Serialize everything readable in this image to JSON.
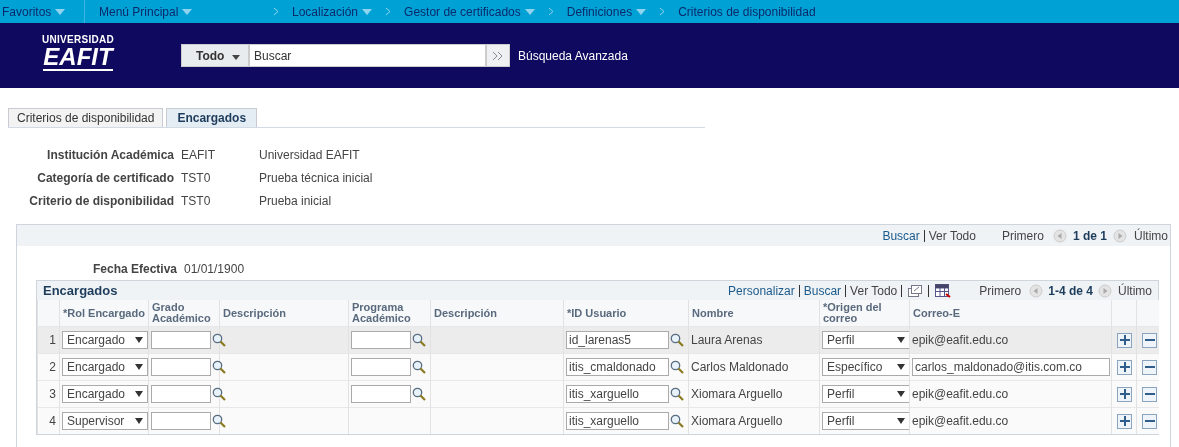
{
  "nav": {
    "items": [
      {
        "label": "Favoritos",
        "dropdown": true
      },
      {
        "label": "Menú Principal",
        "dropdown": true
      },
      {
        "label": "Localización",
        "dropdown": true
      },
      {
        "label": "Gestor de certificados",
        "dropdown": true
      },
      {
        "label": "Definiciones",
        "dropdown": true
      },
      {
        "label": "Criterios de disponibilidad",
        "dropdown": false
      }
    ]
  },
  "header": {
    "logo_top": "UNIVERSIDAD",
    "logo_main": "EAFIT",
    "search_scope": "Todo",
    "search_placeholder": "Buscar",
    "advanced": "Búsqueda Avanzada"
  },
  "tabs": [
    {
      "label": "Criterios de disponibilidad",
      "selected": false
    },
    {
      "label": "Encargados",
      "selected": true
    }
  ],
  "fields": [
    {
      "label": "Institución Académica",
      "code": "EAFIT",
      "description": "Universidad EAFIT"
    },
    {
      "label": "Categoría de certificado",
      "code": "TST0",
      "description": "Prueba técnica inicial"
    },
    {
      "label": "Criterio de disponibilidad",
      "code": "TST0",
      "description": "Prueba inicial"
    }
  ],
  "outer_nav": {
    "find": "Buscar",
    "view_all": "Ver Todo",
    "first": "Primero",
    "count": "1 de 1",
    "last": "Último"
  },
  "effective_date": {
    "label": "Fecha Efectiva",
    "value": "01/01/1900"
  },
  "grid": {
    "title": "Encargados",
    "personalize": "Personalizar",
    "find": "Buscar",
    "view_all": "Ver Todo",
    "first": "Primero",
    "count": "1-4 de 4",
    "last": "Último",
    "columns": [
      {
        "label": "*Rol Encargado"
      },
      {
        "label": "Grado Académico"
      },
      {
        "label": "Descripción"
      },
      {
        "label": "Programa Académico"
      },
      {
        "label": "Descripción"
      },
      {
        "label": "*ID Usuario"
      },
      {
        "label": "Nombre"
      },
      {
        "label": "*Origen del correo"
      },
      {
        "label": "Correo-E"
      }
    ],
    "rows": [
      {
        "number": "1",
        "selected": true,
        "role": "Encargado",
        "program_field": true,
        "user_id": "id_larenas5",
        "name": "Laura Arenas",
        "origin": "Perfil",
        "email": "epik@eafit.edu.co",
        "email_editable": false
      },
      {
        "number": "2",
        "selected": false,
        "role": "Encargado",
        "program_field": true,
        "user_id": "itis_cmaldonado",
        "name": "Carlos Maldonado",
        "origin": "Específico",
        "email": "carlos_maldonado@itis.com.co",
        "email_editable": true
      },
      {
        "number": "3",
        "selected": false,
        "role": "Encargado",
        "program_field": true,
        "user_id": "itis_xarguello",
        "name": "Xiomara Arguello",
        "origin": "Perfil",
        "email": "epik@eafit.edu.co",
        "email_editable": false
      },
      {
        "number": "4",
        "selected": false,
        "role": "Supervisor",
        "program_field": false,
        "user_id": "itis_xarguello",
        "name": "Xiomara Arguello",
        "origin": "Perfil",
        "email": "epik@eafit.edu.co",
        "email_editable": false
      }
    ]
  }
}
